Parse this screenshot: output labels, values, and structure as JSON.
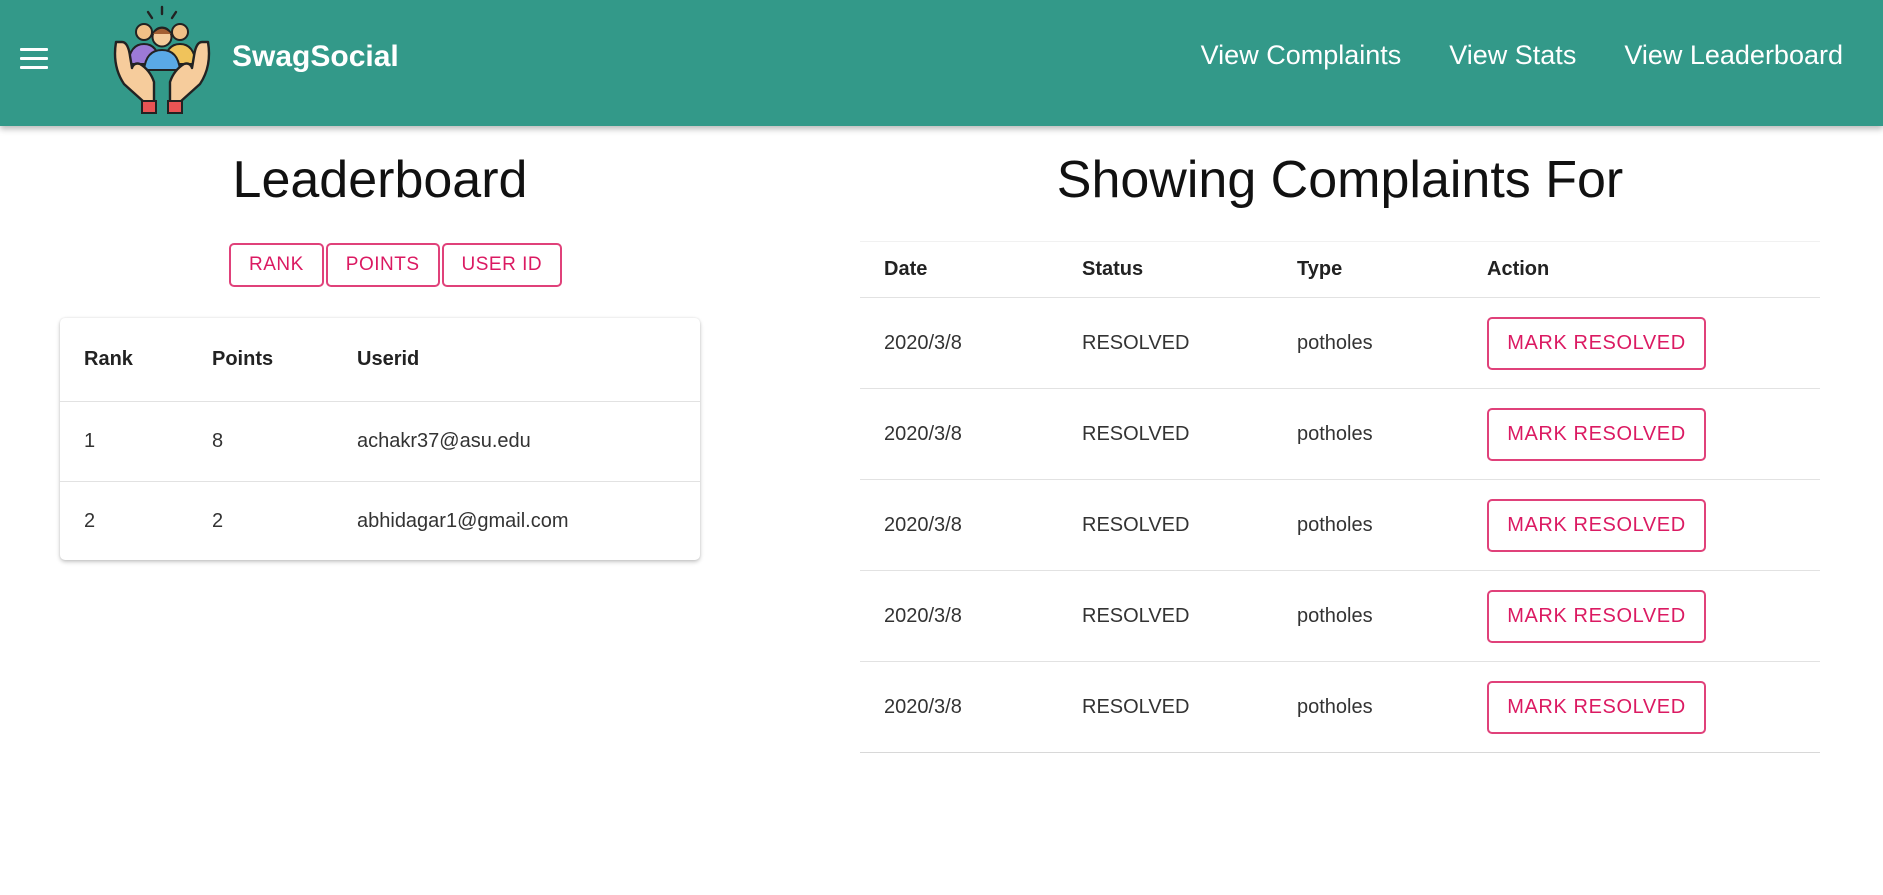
{
  "app": {
    "name": "SwagSocial",
    "nav": [
      "View Complaints",
      "View Stats",
      "View Leaderboard"
    ]
  },
  "colors": {
    "appbar": "#339989",
    "accent": "#db1a62"
  },
  "icons": {
    "menu": "menu-icon",
    "logo": "hands-holding-people-logo"
  },
  "leaderboard": {
    "title": "Leaderboard",
    "sort_buttons": [
      "RANK",
      "POINTS",
      "USER ID"
    ],
    "columns": [
      "Rank",
      "Points",
      "Userid"
    ],
    "rows": [
      {
        "rank": "1",
        "points": "8",
        "userid": "achakr37@asu.edu"
      },
      {
        "rank": "2",
        "points": "2",
        "userid": "abhidagar1@gmail.com"
      }
    ]
  },
  "complaints": {
    "title": "Showing Complaints For",
    "columns": [
      "Date",
      "Status",
      "Type",
      "Action"
    ],
    "rows": [
      {
        "date": "2020/3/8",
        "status": "RESOLVED",
        "type": "potholes",
        "action": "MARK RESOLVED"
      },
      {
        "date": "2020/3/8",
        "status": "RESOLVED",
        "type": "potholes",
        "action": "MARK RESOLVED"
      },
      {
        "date": "2020/3/8",
        "status": "RESOLVED",
        "type": "potholes",
        "action": "MARK RESOLVED"
      },
      {
        "date": "2020/3/8",
        "status": "RESOLVED",
        "type": "potholes",
        "action": "MARK RESOLVED"
      },
      {
        "date": "2020/3/8",
        "status": "RESOLVED",
        "type": "potholes",
        "action": "MARK RESOLVED"
      }
    ]
  }
}
